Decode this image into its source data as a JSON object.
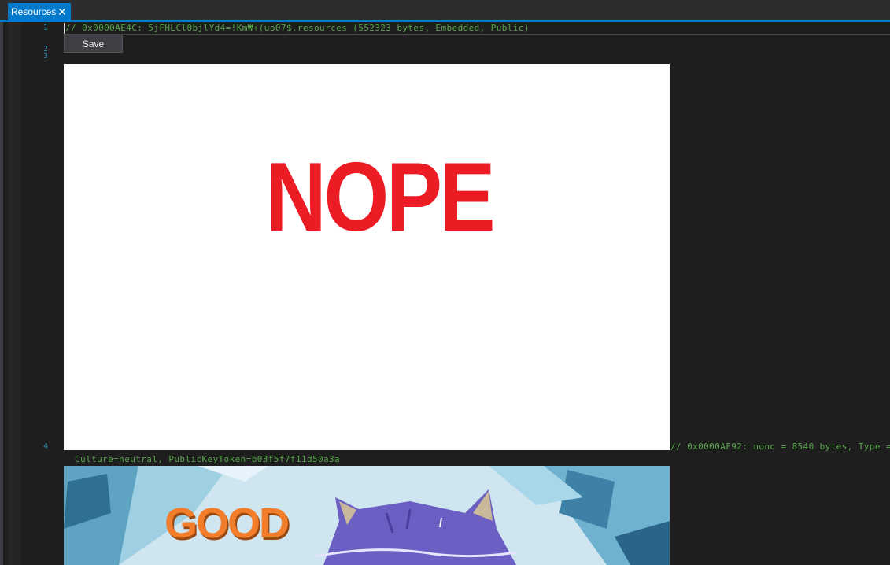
{
  "tab": {
    "label": "Resources",
    "close_glyph": "✕"
  },
  "gutter": {
    "line_numbers": [
      "1",
      "2",
      "3",
      "4"
    ]
  },
  "code": {
    "line1": "// 0x0000AE4C: 5jFHLCl0bjlYd4=!Km₩+(uo07$.resources (552323 bytes, Embedded, Public)",
    "line4": "// 0x0000AF92: nono = 8540 bytes, Type =",
    "line4_wrap": "Culture=neutral, PublicKeyToken=b03f5f7f11d50a3a"
  },
  "save_button": {
    "label": "Save"
  },
  "resource_images": {
    "nope": {
      "text": "NOPE",
      "text_color": "#ec1c24",
      "background": "#ffffff"
    },
    "good": {
      "text": "GOOD",
      "text_color": "#f27d2a"
    }
  },
  "colors": {
    "accent": "#007acc",
    "editor_background": "#1e1e1e",
    "comment": "#57a64a",
    "line_number": "#2b91af"
  }
}
